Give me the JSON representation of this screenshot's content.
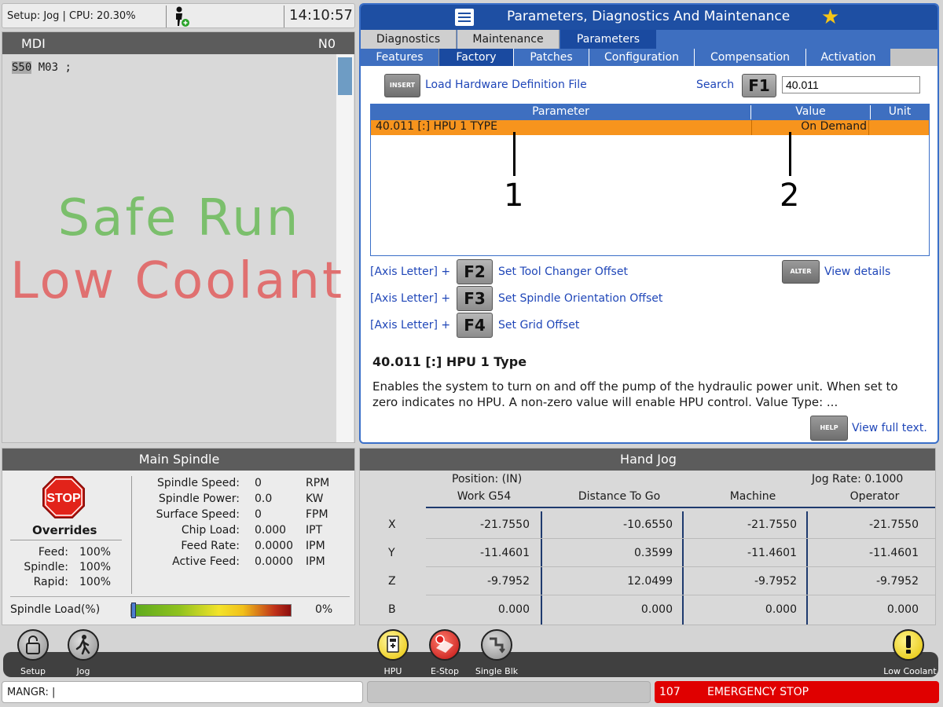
{
  "top_status": {
    "text": "Setup: Jog | CPU: 20.30%",
    "clock": "14:10:57"
  },
  "mdi": {
    "title": "MDI",
    "line_number": "N0",
    "code_highlight": "S50",
    "code_rest": " M03 ;",
    "safe_run": "Safe Run",
    "low_coolant": "Low Coolant"
  },
  "params": {
    "title": "Parameters, Diagnostics And Maintenance",
    "tabs": [
      "Diagnostics",
      "Maintenance",
      "Parameters"
    ],
    "subtabs": [
      "Features",
      "Factory",
      "Patches",
      "Configuration",
      "Compensation",
      "Activation"
    ],
    "insert_key": "INSERT",
    "insert_action": "Load Hardware Definition File",
    "search_label": "Search",
    "search_key": "F1",
    "search_value": "40.011",
    "table": {
      "headers": [
        "Parameter",
        "Value",
        "Unit"
      ],
      "row": {
        "parameter": "40.011 [:] HPU 1 TYPE",
        "value": "On Demand",
        "unit": ""
      }
    },
    "callouts": [
      "1",
      "2"
    ],
    "shortcuts": [
      {
        "prefix": "[Axis Letter] +",
        "key": "F2",
        "label": "Set Tool Changer Offset"
      },
      {
        "prefix": "[Axis Letter] +",
        "key": "F3",
        "label": "Set Spindle Orientation Offset"
      },
      {
        "prefix": "[Axis Letter] +",
        "key": "F4",
        "label": "Set Grid Offset"
      }
    ],
    "alter_key": "ALTER",
    "alter_action": "View details",
    "desc_title": "40.011 [:] HPU 1 Type",
    "desc_text": "Enables the system to turn on and off the pump of the hydraulic power unit. When set to zero indicates no HPU. A non-zero value will enable HPU control. Value Type: ...",
    "help_key": "HELP",
    "help_action": "View full text."
  },
  "spindle": {
    "title": "Main Spindle",
    "stop_label": "STOP",
    "overrides_title": "Overrides",
    "overrides": [
      {
        "label": "Feed:",
        "value": "100%"
      },
      {
        "label": "Spindle:",
        "value": "100%"
      },
      {
        "label": "Rapid:",
        "value": "100%"
      }
    ],
    "stats": [
      {
        "label": "Spindle Speed:",
        "value": "0",
        "unit": "RPM"
      },
      {
        "label": "Spindle Power:",
        "value": "0.0",
        "unit": "KW"
      },
      {
        "label": "Surface Speed:",
        "value": "0",
        "unit": "FPM"
      },
      {
        "label": "Chip Load:",
        "value": "0.000",
        "unit": "IPT"
      },
      {
        "label": "Feed Rate:",
        "value": "0.0000",
        "unit": "IPM"
      },
      {
        "label": "Active Feed:",
        "value": "0.0000",
        "unit": "IPM"
      }
    ],
    "load_label": "Spindle Load(%)",
    "load_value": "0%",
    "load_fraction": 0.0
  },
  "jog": {
    "title": "Hand Jog",
    "position_label": "Position: (IN)",
    "jog_rate": "Jog Rate: 0.1000",
    "columns": [
      "Work G54",
      "Distance To Go",
      "Machine",
      "Operator"
    ],
    "rows": [
      {
        "axis": "X",
        "values": [
          "-21.7550",
          "-10.6550",
          "-21.7550",
          "-21.7550"
        ]
      },
      {
        "axis": "Y",
        "values": [
          "-11.4601",
          "0.3599",
          "-11.4601",
          "-11.4601"
        ]
      },
      {
        "axis": "Z",
        "values": [
          "-9.7952",
          "12.0499",
          "-9.7952",
          "-9.7952"
        ]
      },
      {
        "axis": "B",
        "values": [
          "0.000",
          "0.000",
          "0.000",
          "0.000"
        ]
      }
    ]
  },
  "icon_bar": {
    "setup": "Setup",
    "jog": "Jog",
    "hpu": "HPU",
    "estop": "E-Stop",
    "single_blk": "Single Blk",
    "low_coolant": "Low Coolant"
  },
  "footer": {
    "input_value": "MANGR: |",
    "alarm_code": "107",
    "alarm_text": "EMERGENCY STOP"
  },
  "colors": {
    "accent_blue": "#1e4fa3",
    "selected_row": "#f7941d",
    "alarm_red": "#e00000",
    "safe_run_green": "#7bbf6c",
    "low_coolant_red": "#e07070"
  }
}
